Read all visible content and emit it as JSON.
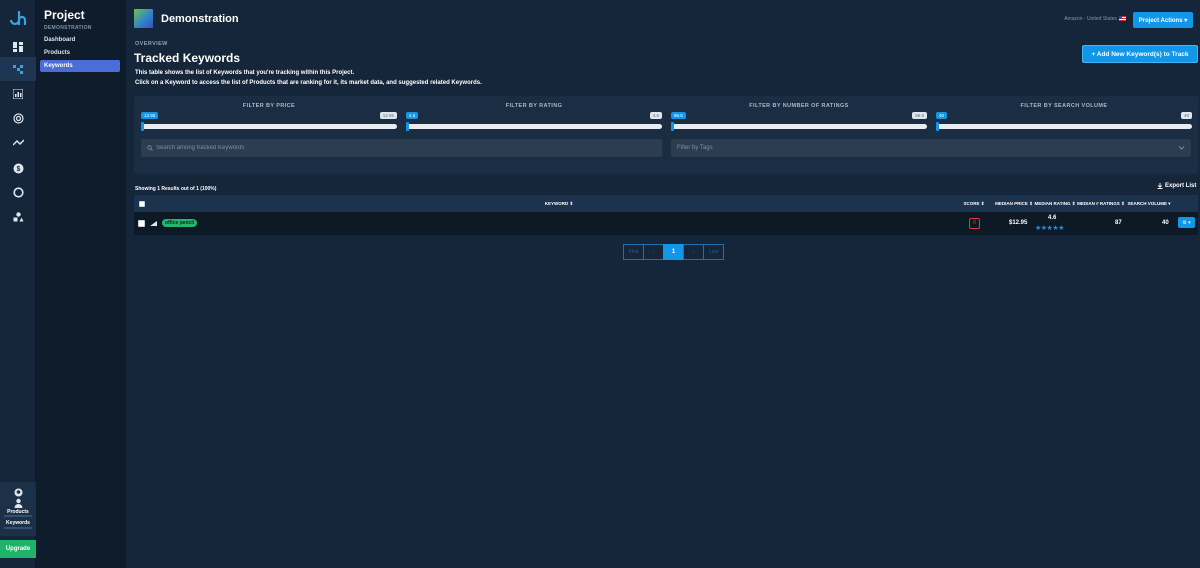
{
  "rail": {
    "products_label": "Products",
    "keywords_label": "Keywords",
    "upgrade_label": "Upgrade"
  },
  "sidebar": {
    "title": "Project",
    "subtitle": "DEMONSTRATION",
    "items": [
      {
        "label": "Dashboard"
      },
      {
        "label": "Products"
      },
      {
        "label": "Keywords"
      }
    ]
  },
  "header": {
    "project_name": "Demonstration",
    "marketplace": "Amazon - United States",
    "actions_label": "Project Actions ▾"
  },
  "overview": {
    "overline": "OVERVIEW",
    "title": "Tracked Keywords",
    "desc_line1": "This table shows the list of Keywords that you're tracking within this Project.",
    "desc_line2": "Click on a Keyword to access the list of Products that are ranking for it, its market data, and suggested related Keywords.",
    "add_button": "+ Add New Keyword(s) to Track"
  },
  "filters": [
    {
      "label": "FILTER BY PRICE",
      "min": "12.95",
      "max": "12.95"
    },
    {
      "label": "FILTER BY RATING",
      "min": "4.6",
      "max": "4.6"
    },
    {
      "label": "FILTER BY NUMBER OF RATINGS",
      "min": "86.5",
      "max": "86.5"
    },
    {
      "label": "FILTER BY SEARCH VOLUME",
      "min": "40",
      "max": "40"
    }
  ],
  "search": {
    "placeholder": "Search among tracked Keywords"
  },
  "tags": {
    "placeholder": "Filter by Tags"
  },
  "results": {
    "showing": "Showing 1 Results out of 1 (100%)",
    "export_label": "Export List"
  },
  "table": {
    "headers": {
      "keyword": "KEYWORD ⇕",
      "score": "SCORE ⇕",
      "median_price": "MEDIAN PRICE ⇕",
      "median_rating": "MEDIAN RATING ⇕",
      "median_ratings": "MEDIAN # RATINGS ⇕",
      "search_volume": "SEARCH VOLUME ▾"
    },
    "rows": [
      {
        "keyword": "office pencil",
        "score": "0",
        "median_price": "$12.95",
        "median_rating": "4.6",
        "stars": "★★★★★",
        "median_ratings": "87",
        "search_volume": "40",
        "action_label": "⚙ ▾"
      }
    ]
  },
  "pagination": {
    "first": "First",
    "prev": "‹",
    "current": "1",
    "next": "›",
    "last": "Last"
  },
  "colors": {
    "accent": "#1297e8",
    "upgrade": "#1db46a",
    "keyword_badge": "#26b56e",
    "score_bad": "#e0383c",
    "background": "#15253a"
  }
}
